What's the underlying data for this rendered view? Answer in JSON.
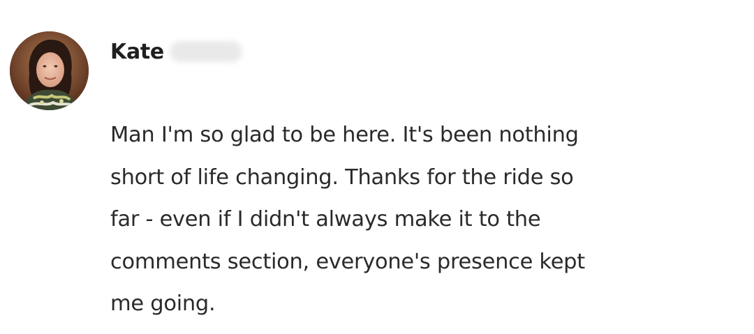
{
  "comment": {
    "author_first_name": "Kate",
    "body_lines": [
      "Man I'm so glad to be here. It's been nothing",
      "short of life changing. Thanks for the ride so",
      "far - even if I didn't always make it to the",
      "comments section, everyone's presence kept",
      "me going."
    ],
    "avatar_icon": "user-photo-avatar"
  },
  "colors": {
    "text": "#2a2a2a",
    "name": "#1f1f1f",
    "background": "#ffffff"
  }
}
